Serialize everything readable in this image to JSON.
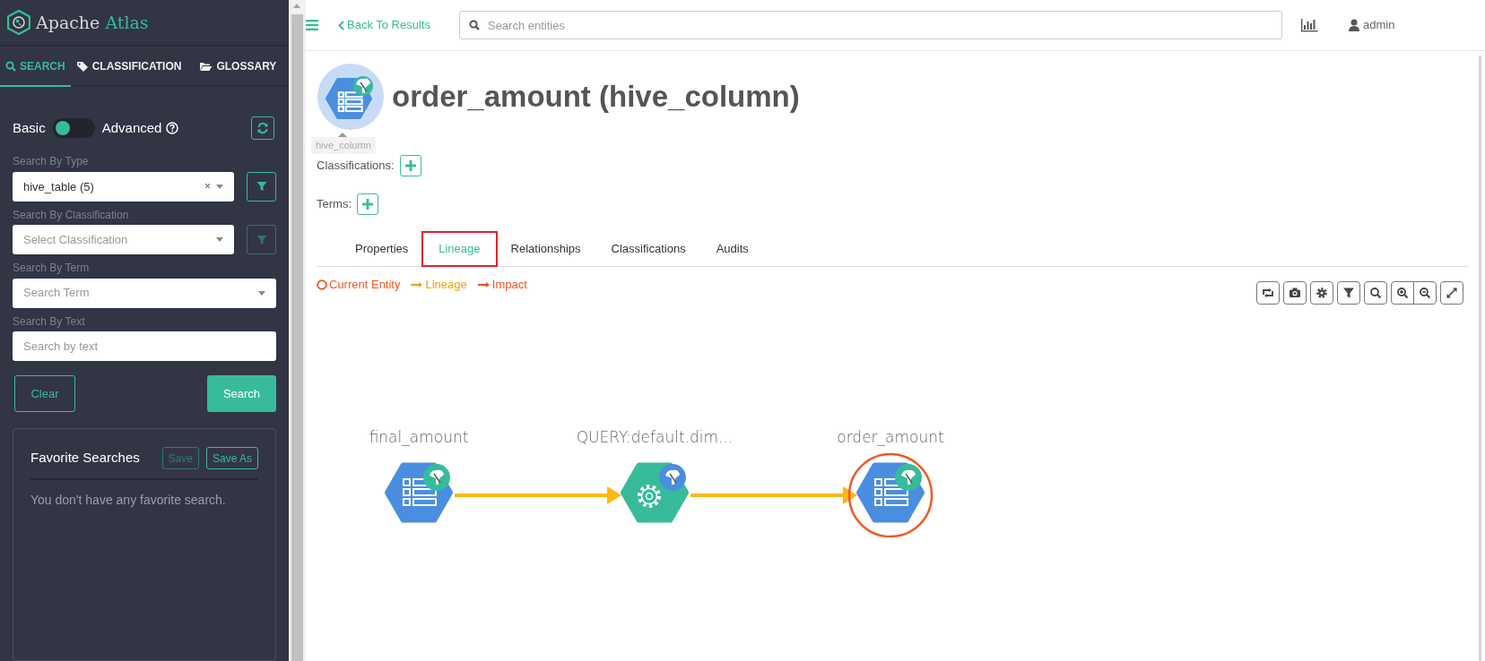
{
  "logo": {
    "name": "Apache",
    "accent": "Atlas"
  },
  "sidebar_tabs": [
    {
      "label": "SEARCH",
      "selected": true
    },
    {
      "label": "CLASSIFICATION",
      "selected": false
    },
    {
      "label": "GLOSSARY",
      "selected": false
    }
  ],
  "search_mode": {
    "left": "Basic",
    "right": "Advanced",
    "advanced": false
  },
  "filters": [
    {
      "label": "Search By Type",
      "kind": "select",
      "value": "hive_table (5)",
      "clear_mark": "×",
      "filter": {
        "disabled": false
      }
    },
    {
      "label": "Search By Classification",
      "kind": "select",
      "placeholder": "Select Classification",
      "filter": {
        "disabled": true
      }
    },
    {
      "label": "Search By Term",
      "kind": "select",
      "placeholder": "Search Term"
    },
    {
      "label": "Search By Text",
      "kind": "text",
      "placeholder": "Search by text"
    }
  ],
  "actions": [
    {
      "label": "Clear",
      "kind": "outline"
    },
    {
      "label": "Search",
      "kind": "primary"
    }
  ],
  "favorites": {
    "title": "Favorite Searches",
    "buttons": [
      {
        "label": "Save",
        "disabled": true
      },
      {
        "label": "Save As",
        "disabled": false
      }
    ],
    "empty_text": "You don't have any favorite search."
  },
  "topbar": {
    "back_link": "Back To Results",
    "search_placeholder": "Search entities",
    "user": "admin"
  },
  "entity": {
    "title": "order_amount (hive_column)",
    "tooltip": "hive_column"
  },
  "attributes": [
    {
      "label": "Classifications:"
    },
    {
      "label": "Terms:"
    }
  ],
  "detail_tabs": [
    {
      "label": "Properties",
      "selected": false
    },
    {
      "label": "Lineage",
      "selected": true
    },
    {
      "label": "Relationships",
      "selected": false
    },
    {
      "label": "Classifications",
      "selected": false
    },
    {
      "label": "Audits",
      "selected": false
    }
  ],
  "legend": [
    {
      "label": "Current Entity",
      "kind": "circle",
      "color": "#f05a28"
    },
    {
      "label": "Lineage",
      "kind": "arrow",
      "color": "#e9a40c"
    },
    {
      "label": "Impact",
      "kind": "arrow",
      "color": "#f0501e"
    }
  ],
  "lineage": {
    "nodes": [
      {
        "label": "final_amount",
        "kind": "column",
        "current": false
      },
      {
        "label": "QUERY:default.dim...",
        "kind": "process",
        "current": false
      },
      {
        "label": "order_amount",
        "kind": "column",
        "current": true
      }
    ]
  }
}
